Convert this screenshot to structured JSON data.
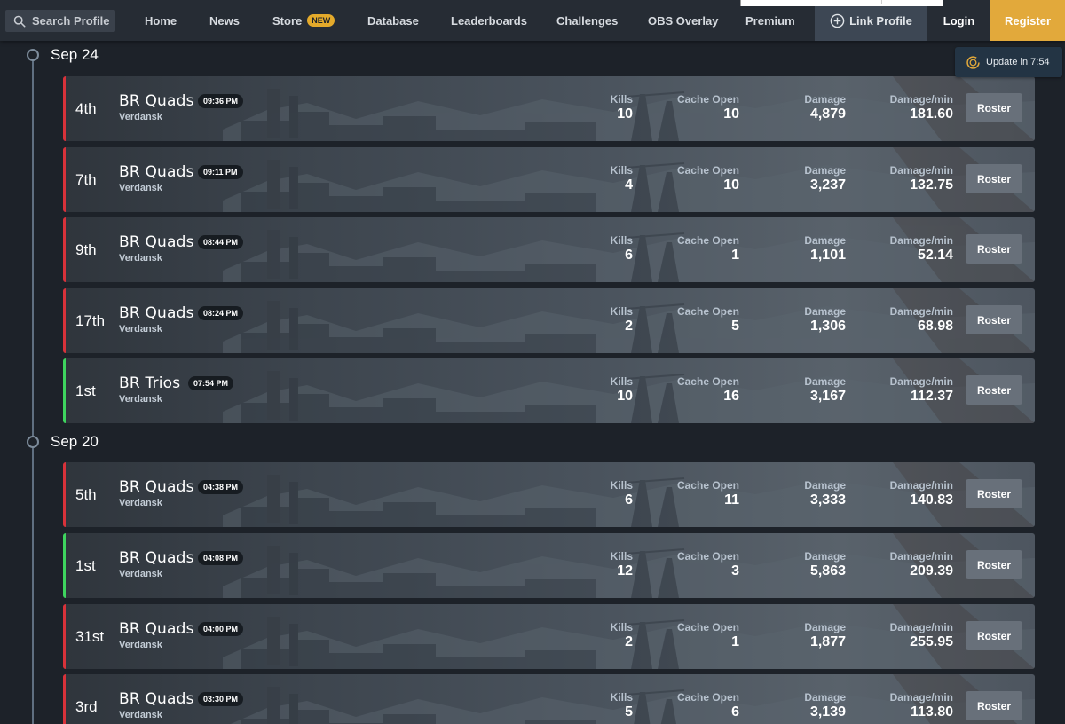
{
  "nav": {
    "search_label": "Search Profile",
    "links": [
      {
        "label": "Home"
      },
      {
        "label": "News"
      },
      {
        "label": "Store",
        "badge": "NEW"
      },
      {
        "label": "Database"
      },
      {
        "label": "Leaderboards"
      },
      {
        "label": "Challenges"
      },
      {
        "label": "OBS Overlay"
      },
      {
        "label": "Premium"
      }
    ],
    "link_profile_label": "Link Profile",
    "login_label": "Login",
    "register_label": "Register",
    "accent_color": "#e2a93b"
  },
  "update_badge": {
    "label": "Update in 7:54"
  },
  "stat_labels": {
    "kills": "Kills",
    "cache": "Cache Open",
    "damage": "Damage",
    "dpm": "Damage/min",
    "roster": "Roster"
  },
  "colors": {
    "loss": "#d8323a",
    "win": "#3ed45e"
  },
  "days": [
    {
      "date": "Sep 24",
      "matches": [
        {
          "placement": "4th",
          "mode": "BR Quads",
          "map": "Verdansk",
          "time": "09:36 PM",
          "kills": "10",
          "cache": "10",
          "damage": "4,879",
          "dpm": "181.60",
          "result": "loss"
        },
        {
          "placement": "7th",
          "mode": "BR Quads",
          "map": "Verdansk",
          "time": "09:11 PM",
          "kills": "4",
          "cache": "10",
          "damage": "3,237",
          "dpm": "132.75",
          "result": "loss"
        },
        {
          "placement": "9th",
          "mode": "BR Quads",
          "map": "Verdansk",
          "time": "08:44 PM",
          "kills": "6",
          "cache": "1",
          "damage": "1,101",
          "dpm": "52.14",
          "result": "loss"
        },
        {
          "placement": "17th",
          "mode": "BR Quads",
          "map": "Verdansk",
          "time": "08:24 PM",
          "kills": "2",
          "cache": "5",
          "damage": "1,306",
          "dpm": "68.98",
          "result": "loss"
        },
        {
          "placement": "1st",
          "mode": "BR Trios",
          "map": "Verdansk",
          "time": "07:54 PM",
          "kills": "10",
          "cache": "16",
          "damage": "3,167",
          "dpm": "112.37",
          "result": "win"
        }
      ]
    },
    {
      "date": "Sep 20",
      "matches": [
        {
          "placement": "5th",
          "mode": "BR Quads",
          "map": "Verdansk",
          "time": "04:38 PM",
          "kills": "6",
          "cache": "11",
          "damage": "3,333",
          "dpm": "140.83",
          "result": "loss"
        },
        {
          "placement": "1st",
          "mode": "BR Quads",
          "map": "Verdansk",
          "time": "04:08 PM",
          "kills": "12",
          "cache": "3",
          "damage": "5,863",
          "dpm": "209.39",
          "result": "win"
        },
        {
          "placement": "31st",
          "mode": "BR Quads",
          "map": "Verdansk",
          "time": "04:00 PM",
          "kills": "2",
          "cache": "1",
          "damage": "1,877",
          "dpm": "255.95",
          "result": "loss"
        },
        {
          "placement": "3rd",
          "mode": "BR Quads",
          "map": "Verdansk",
          "time": "03:30 PM",
          "kills": "5",
          "cache": "6",
          "damage": "3,139",
          "dpm": "113.80",
          "result": "loss"
        }
      ]
    }
  ]
}
